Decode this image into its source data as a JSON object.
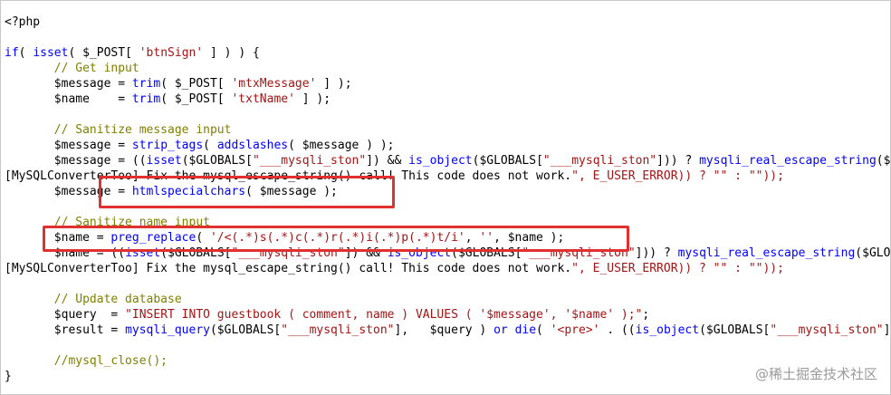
{
  "code_lines": [
    "<?php",
    "",
    "if( isset( $_POST[ 'btnSign' ] ) ) {",
    "       // Get input",
    "       $message = trim( $_POST[ 'mtxMessage' ] );",
    "       $name    = trim( $_POST[ 'txtName' ] );",
    "",
    "       // Sanitize message input",
    "       $message = strip_tags( addslashes( $message ) );",
    "       $message = ((isset($GLOBALS[\"___mysqli_ston\"]) && is_object($GLOBALS[\"___mysqli_ston\"])) ? mysqli_real_escape_string($GLOBALS[\"___mysqli_ston\"], $message ) :",
    "[MySQLConverterToo] Fix the mysql_escape_string() call! This code does not work.\", E_USER_ERROR)) ? \"\" : \"\"));",
    "       $message = htmlspecialchars( $message );",
    "",
    "       // Sanitize name input",
    "       $name = preg_replace( '/<(.*)s(.*)c(.*)r(.*)i(.*)p(.*)t/i', '', $name );",
    "       $name = ((isset($GLOBALS[\"___mysqli_ston\"]) && is_object($GLOBALS[\"___mysqli_ston\"])) ? mysqli_real_escape_string($GLOBALS[\"___mysqli_ston\"], $name ) :",
    "[MySQLConverterToo] Fix the mysql_escape_string() call! This code does not work.\", E_USER_ERROR)) ? \"\" : \"\"));",
    "",
    "       // Update database",
    "       $query  = \"INSERT INTO guestbook ( comment, name ) VALUES ( '$message', '$name' );\";",
    "       $result = mysqli_query($GLOBALS[\"___mysqli_ston\"],   $query ) or die( '<pre>' . ((is_object($GLOBALS[\"___mysqli_ston\"])) ? mysqli_error($GLOBALS[\"___mysqli_ston\"]) :",
    "",
    "       //mysql_close();",
    "}"
  ],
  "watermark": {
    "text": "@稀土掘金技术社区"
  },
  "colors": {
    "keyword": "#0000ff",
    "string": "#a31515",
    "comment": "#808000",
    "highlight_border": "#e0302f"
  }
}
